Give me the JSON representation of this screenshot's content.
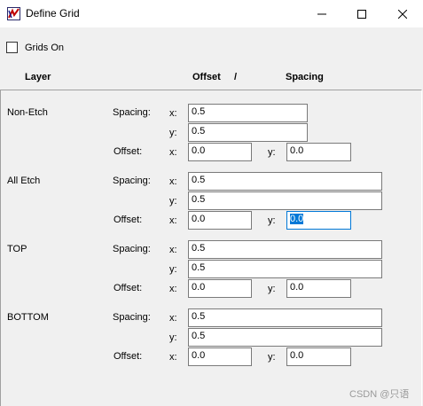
{
  "window": {
    "title": "Define Grid",
    "icon": "grid-app-icon"
  },
  "controls": {
    "min": "minimize-icon",
    "max": "maximize-icon",
    "close": "close-icon"
  },
  "grids_on": {
    "label": "Grids On",
    "checked": false
  },
  "headers": {
    "layer": "Layer",
    "offset": "Offset",
    "slash": "/",
    "spacing": "Spacing"
  },
  "labels": {
    "spacing": "Spacing:",
    "offset": "Offset:",
    "x": "x:",
    "y": "y:"
  },
  "layers": [
    {
      "name": "Non-Etch",
      "spacing_x": "0.5",
      "spacing_y": "0.5",
      "offset_x": "0.0",
      "offset_y": "0.0"
    },
    {
      "name": "All Etch",
      "spacing_x": "0.5",
      "spacing_y": "0.5",
      "offset_x": "0.0",
      "offset_y": "0.0"
    },
    {
      "name": "TOP",
      "spacing_x": "0.5",
      "spacing_y": "0.5",
      "offset_x": "0.0",
      "offset_y": "0.0"
    },
    {
      "name": "BOTTOM",
      "spacing_x": "0.5",
      "spacing_y": "0.5",
      "offset_x": "0.0",
      "offset_y": "0.0"
    }
  ],
  "watermark": "CSDN @只语"
}
